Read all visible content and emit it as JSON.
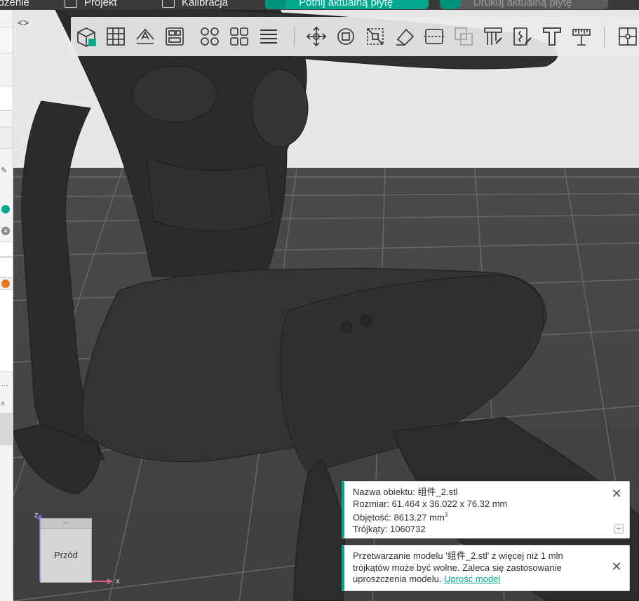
{
  "menubar": {
    "items": [
      "Urządzenie",
      "Projekt",
      "Kalibracja"
    ],
    "slice_button": "Potnij aktualną płytę",
    "print_button": "Drukuj aktualną płytę"
  },
  "colors": {
    "accent": "#00a88e",
    "viewport_bg": "#e7e7e7",
    "bed": "#444444",
    "model": "#2a2a2a"
  },
  "toolbar": {
    "groups": [
      [
        "add-cube-icon",
        "grid-arrange-icon",
        "auto-orient-icon",
        "plate-layout-icon"
      ],
      [
        "split-objects-icon",
        "split-parts-icon",
        "layers-icon"
      ],
      [
        "move-icon",
        "rotate-icon",
        "scale-icon",
        "paint-support-icon",
        "cut-icon",
        "mesh-boolean-icon"
      ],
      [
        "supports-paint-icon",
        "seam-paint-icon",
        "text-emboss-icon",
        "measure-icon"
      ],
      [
        "assembly-icon"
      ]
    ]
  },
  "viewcube": {
    "front_label": "Przód",
    "x_label": "x",
    "z_label": "z"
  },
  "object_info": {
    "name_line": "Nazwa obiektu: 组件_2.stl",
    "size_line": "Rozmiar: 61.464 x 36.022 x 76.32 mm",
    "volume_line": "Objętość: 8613.27 mm",
    "volume_unit_exp": "3",
    "triangles_line": "Trójkąty: 1060732"
  },
  "warning": {
    "text": "Przetwarzanie modelu '组件_2.stl' z więcej niż 1 mln trójkątów może być wolne. Zaleca się zastosowanie uproszczenia modelu.",
    "link": "Uprość model"
  }
}
